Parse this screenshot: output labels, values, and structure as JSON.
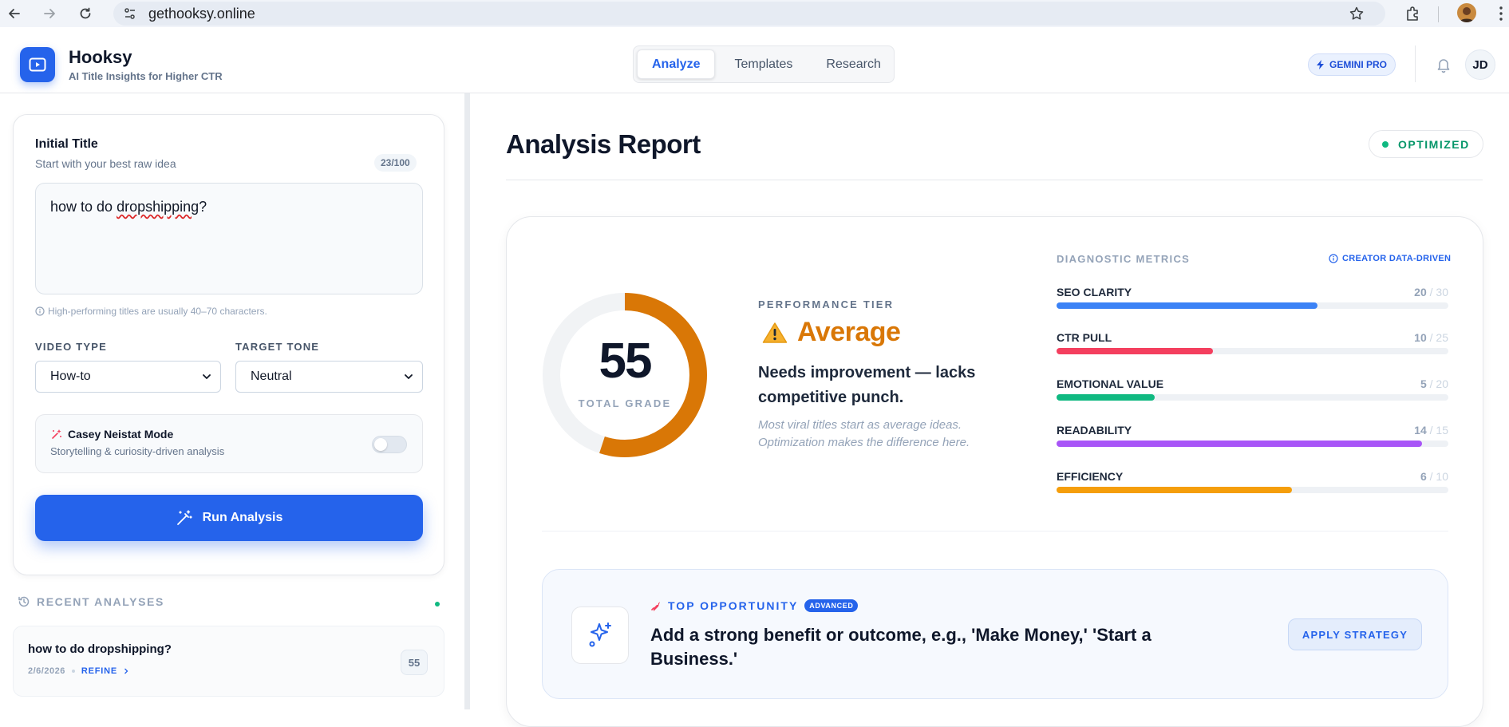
{
  "browser": {
    "url": "gethooksy.online"
  },
  "header": {
    "brand": "Hooksy",
    "tagline": "AI Title Insights for Higher CTR",
    "tabs": [
      {
        "label": "Analyze",
        "active": true
      },
      {
        "label": "Templates",
        "active": false
      },
      {
        "label": "Research",
        "active": false
      }
    ],
    "plan_badge": "GEMINI PRO",
    "avatar_initials": "JD"
  },
  "input_panel": {
    "title_label": "Initial Title",
    "title_sub": "Start with your best raw idea",
    "char_count": "23/100",
    "title_value": "how to do dropshipping?",
    "hint": "High-performing titles are usually 40–70 characters.",
    "video_type_label": "VIDEO TYPE",
    "video_type_value": "How-to",
    "tone_label": "TARGET TONE",
    "tone_value": "Neutral",
    "casey_title": "Casey Neistat Mode",
    "casey_sub": "Storytelling & curiosity-driven analysis",
    "casey_enabled": false,
    "run_button": "Run Analysis"
  },
  "recent": {
    "header": "RECENT ANALYSES",
    "items": [
      {
        "title": "how to do dropshipping?",
        "date": "2/6/2026",
        "action": "REFINE",
        "score": "55"
      }
    ]
  },
  "report": {
    "title": "Analysis Report",
    "status": "OPTIMIZED",
    "score": "55",
    "score_max": 100,
    "score_label": "TOTAL GRADE",
    "tier_label": "PERFORMANCE TIER",
    "tier_value": "Average",
    "tier_desc": "Needs improvement — lacks competitive punch.",
    "tier_note": "Most viral titles start as average ideas. Optimization makes the difference here.",
    "diagnostics_header": "DIAGNOSTIC METRICS",
    "diagnostics_tag": "CREATOR DATA-DRIVEN",
    "metrics": [
      {
        "label": "SEO CLARITY",
        "score": "20",
        "max": "/ 30",
        "color": "#3b82f6",
        "fraction": 0.667
      },
      {
        "label": "CTR PULL",
        "score": "10",
        "max": "/ 25",
        "color": "#f43f5e",
        "fraction": 0.4
      },
      {
        "label": "EMOTIONAL VALUE",
        "score": "5",
        "max": "/ 20",
        "color": "#10b981",
        "fraction": 0.25
      },
      {
        "label": "READABILITY",
        "score": "14",
        "max": "/ 15",
        "color": "#a855f7",
        "fraction": 0.933
      },
      {
        "label": "EFFICIENCY",
        "score": "6",
        "max": "/ 10",
        "color": "#f59e0b",
        "fraction": 0.6
      }
    ],
    "opportunity_label": "TOP OPPORTUNITY",
    "opportunity_badge": "ADVANCED",
    "opportunity_text": "Add a strong benefit or outcome, e.g., 'Make Money,' 'Start a Business.'",
    "apply_button": "APPLY STRATEGY"
  },
  "colors": {
    "accent": "#2563eb",
    "tier": "#d97706",
    "gauge": "#d97706",
    "success": "#10b981"
  }
}
